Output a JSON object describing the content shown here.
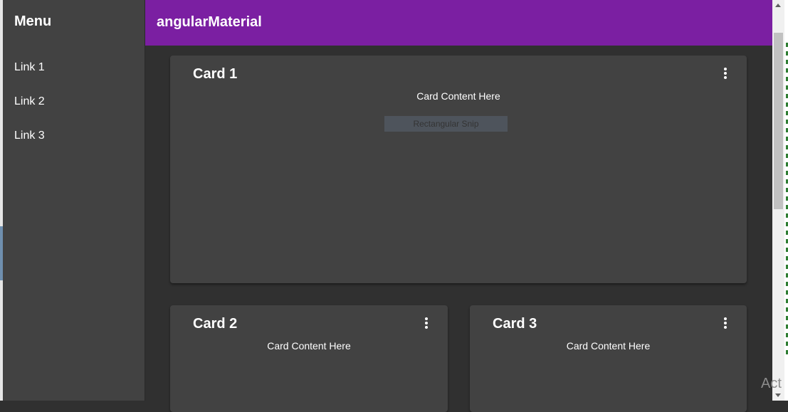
{
  "sidebar": {
    "title": "Menu",
    "links": [
      {
        "label": "Link 1"
      },
      {
        "label": "Link 2"
      },
      {
        "label": "Link 3"
      }
    ]
  },
  "toolbar": {
    "title": "angularMaterial"
  },
  "cards": [
    {
      "title": "Card 1",
      "content": "Card Content Here",
      "menu_icon": "more-vert-icon"
    },
    {
      "title": "Card 2",
      "content": "Card Content Here",
      "menu_icon": "more-vert-icon"
    },
    {
      "title": "Card 3",
      "content": "Card Content Here",
      "menu_icon": "more-vert-icon"
    }
  ],
  "overlay": {
    "snip_label": "Rectangular Snip"
  },
  "watermark": {
    "text": "Act"
  },
  "colors": {
    "toolbar": "#7b1fa2",
    "background": "#303030",
    "surface": "#424242",
    "text": "#ffffff"
  }
}
